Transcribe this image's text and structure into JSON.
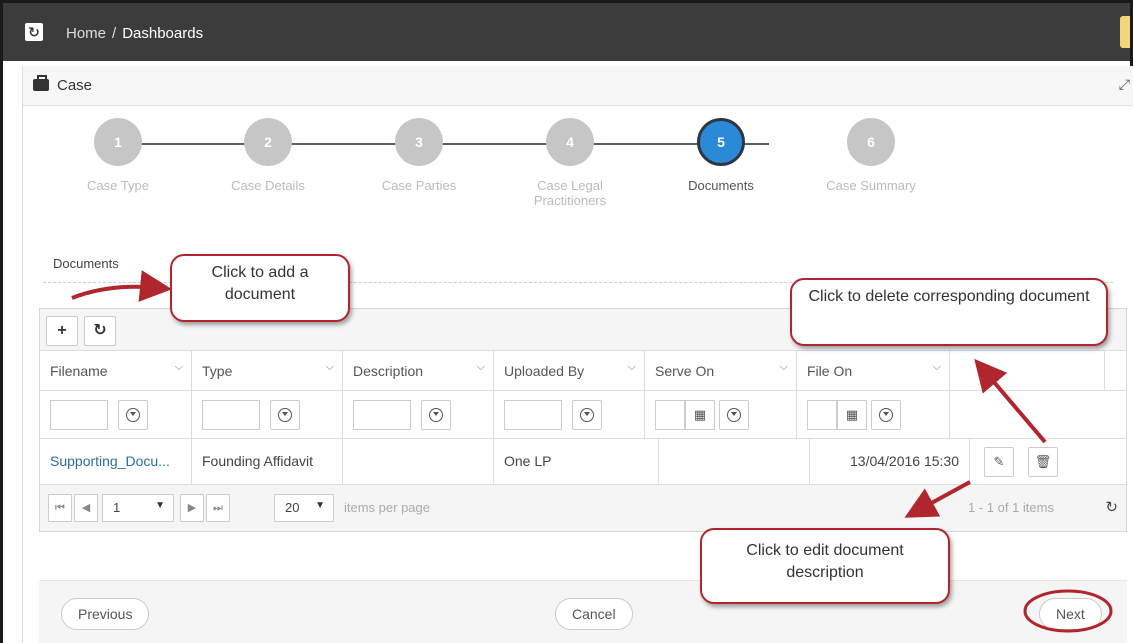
{
  "breadcrumb": {
    "home": "Home",
    "separator": "/",
    "current": "Dashboards"
  },
  "panel": {
    "title": "Case"
  },
  "steps": [
    {
      "num": "1",
      "label": "Case Type",
      "active": false
    },
    {
      "num": "2",
      "label": "Case Details",
      "active": false
    },
    {
      "num": "3",
      "label": "Case Parties",
      "active": false
    },
    {
      "num": "4",
      "label": "Case Legal Practitioners",
      "active": false
    },
    {
      "num": "5",
      "label": "Documents",
      "active": true
    },
    {
      "num": "6",
      "label": "Case Summary",
      "active": false
    }
  ],
  "documents_tab": "Documents",
  "toolbar": {
    "add_glyph": "+",
    "refresh_glyph": "↻"
  },
  "columns": [
    "Filename",
    "Type",
    "Description",
    "Uploaded By",
    "Serve On",
    "File On"
  ],
  "rows": [
    {
      "filename": "Supporting_Docu...",
      "type": "Founding Affidavit",
      "description": "",
      "uploaded_by": "One LP",
      "serve_on": "",
      "file_on": "13/04/2016 15:30"
    }
  ],
  "pager": {
    "page": "1",
    "page_size": "20",
    "items_per_page": "items per page",
    "summary": "1 - 1 of 1 items"
  },
  "footer": {
    "previous": "Previous",
    "cancel": "Cancel",
    "next": "Next"
  },
  "callouts": {
    "add": "Click to add a document",
    "delete": "Click to delete corresponding document",
    "edit": "Click to edit document description"
  },
  "annotation_color": "#b0262c",
  "active_step_color": "#2b8ad8"
}
